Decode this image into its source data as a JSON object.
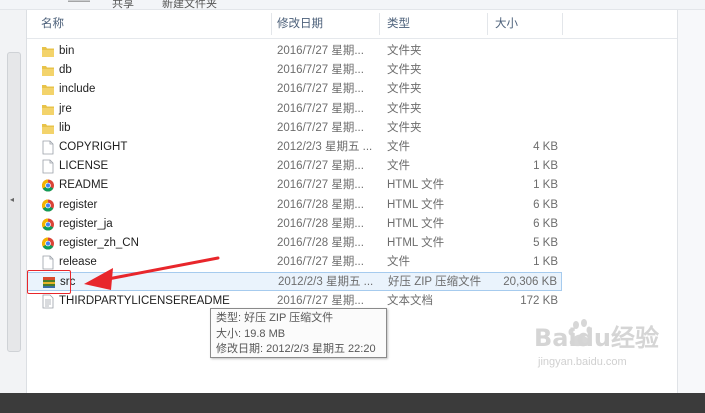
{
  "toolbar": {
    "item1": "——",
    "item2": "共享",
    "item3": "新建文件夹"
  },
  "columns": {
    "name": "名称",
    "date": "修改日期",
    "type": "类型",
    "size": "大小"
  },
  "files": [
    {
      "name": "bin",
      "date": "2016/7/27 星期...",
      "type": "文件夹",
      "size": "",
      "icon": "folder-icon"
    },
    {
      "name": "db",
      "date": "2016/7/27 星期...",
      "type": "文件夹",
      "size": "",
      "icon": "folder-icon"
    },
    {
      "name": "include",
      "date": "2016/7/27 星期...",
      "type": "文件夹",
      "size": "",
      "icon": "folder-icon"
    },
    {
      "name": "jre",
      "date": "2016/7/27 星期...",
      "type": "文件夹",
      "size": "",
      "icon": "folder-icon"
    },
    {
      "name": "lib",
      "date": "2016/7/27 星期...",
      "type": "文件夹",
      "size": "",
      "icon": "folder-icon"
    },
    {
      "name": "COPYRIGHT",
      "date": "2012/2/3 星期五 ...",
      "type": "文件",
      "size": "4 KB",
      "icon": "file-icon"
    },
    {
      "name": "LICENSE",
      "date": "2016/7/27 星期...",
      "type": "文件",
      "size": "1 KB",
      "icon": "file-icon"
    },
    {
      "name": "README",
      "date": "2016/7/27 星期...",
      "type": "HTML 文件",
      "size": "1 KB",
      "icon": "chrome-icon"
    },
    {
      "name": "register",
      "date": "2016/7/28 星期...",
      "type": "HTML 文件",
      "size": "6 KB",
      "icon": "chrome-icon"
    },
    {
      "name": "register_ja",
      "date": "2016/7/28 星期...",
      "type": "HTML 文件",
      "size": "6 KB",
      "icon": "chrome-icon"
    },
    {
      "name": "register_zh_CN",
      "date": "2016/7/28 星期...",
      "type": "HTML 文件",
      "size": "5 KB",
      "icon": "chrome-icon"
    },
    {
      "name": "release",
      "date": "2016/7/27 星期...",
      "type": "文件",
      "size": "1 KB",
      "icon": "file-icon"
    },
    {
      "name": "src",
      "date": "2012/2/3 星期五 ...",
      "type": "好压 ZIP 压缩文件",
      "size": "20,306 KB",
      "icon": "zip-archive-icon",
      "selected": true
    },
    {
      "name": "THIRDPARTYLICENSEREADME",
      "date": "2016/7/27 星期...",
      "type": "文本文档",
      "size": "172 KB",
      "icon": "text-file-icon"
    }
  ],
  "tooltip": {
    "line1": "类型: 好压 ZIP 压缩文件",
    "line2": "大小: 19.8 MB",
    "line3": "修改日期: 2012/2/3 星期五 22:20"
  },
  "watermark": {
    "brand": "Baidu经验",
    "url": "jingyan.baidu.com"
  },
  "colors": {
    "header_text": "#4c607a",
    "selection_bg": "#eaf3fc",
    "selection_border": "#a6cbee",
    "annotation_red": "#e8262b",
    "folder_yellow": "#e8c34a"
  }
}
